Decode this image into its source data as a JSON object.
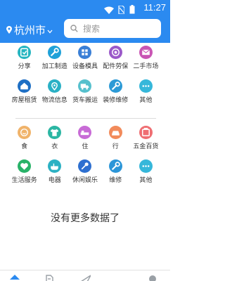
{
  "status_bar": {
    "time": "11:27"
  },
  "header": {
    "city": "杭州市",
    "search_placeholder": "搜索"
  },
  "colors": {
    "primary": "#2b8af0",
    "divider": "#dcdcdc"
  },
  "category_groups": [
    {
      "items": [
        {
          "label": "分享",
          "icon": "share-icon",
          "color": "#26b5c0"
        },
        {
          "label": "加工制造",
          "icon": "wrench-icon",
          "color": "#1fa1d8"
        },
        {
          "label": "设备模具",
          "icon": "grid-icon",
          "color": "#3a7fd6"
        },
        {
          "label": "配件劳保",
          "icon": "target-icon",
          "color": "#9b59c9"
        },
        {
          "label": "二手市场",
          "icon": "mail-icon",
          "color": "#c955b4"
        },
        {
          "label": "房屋租赁",
          "icon": "house-icon",
          "color": "#1e6fc4"
        },
        {
          "label": "物流信息",
          "icon": "map-pin-icon",
          "color": "#2ab0c5"
        },
        {
          "label": "货车搬运",
          "icon": "truck-icon",
          "color": "#56c0cd"
        },
        {
          "label": "装修维修",
          "icon": "wrench-icon",
          "color": "#2c9ad6"
        },
        {
          "label": "其他",
          "icon": "more-icon",
          "color": "#36b7da"
        }
      ]
    },
    {
      "items": [
        {
          "label": "食",
          "icon": "smile-icon",
          "color": "#f0b36a"
        },
        {
          "label": "衣",
          "icon": "shirt-icon",
          "color": "#2bb6a3"
        },
        {
          "label": "住",
          "icon": "bed-icon",
          "color": "#c86bd6"
        },
        {
          "label": "行",
          "icon": "car-icon",
          "color": "#f28b5b"
        },
        {
          "label": "五金百货",
          "icon": "hardware-icon",
          "color": "#ef6e72"
        },
        {
          "label": "生活服务",
          "icon": "heart-icon",
          "color": "#28b268"
        },
        {
          "label": "电器",
          "icon": "pot-icon",
          "color": "#2cb1c3"
        },
        {
          "label": "休闲娱乐",
          "icon": "mic-icon",
          "color": "#2d6fd0"
        },
        {
          "label": "维修",
          "icon": "wrench-icon",
          "color": "#2c96d8"
        },
        {
          "label": "其他",
          "icon": "more-icon",
          "color": "#36b7da"
        }
      ]
    }
  ],
  "footer_text": "没有更多数据了",
  "bottom_nav": [
    {
      "icon": "home-icon",
      "active": true
    },
    {
      "icon": "document-icon",
      "active": false
    },
    {
      "icon": "send-icon",
      "active": false
    },
    {
      "icon": "user-icon",
      "active": false
    }
  ]
}
